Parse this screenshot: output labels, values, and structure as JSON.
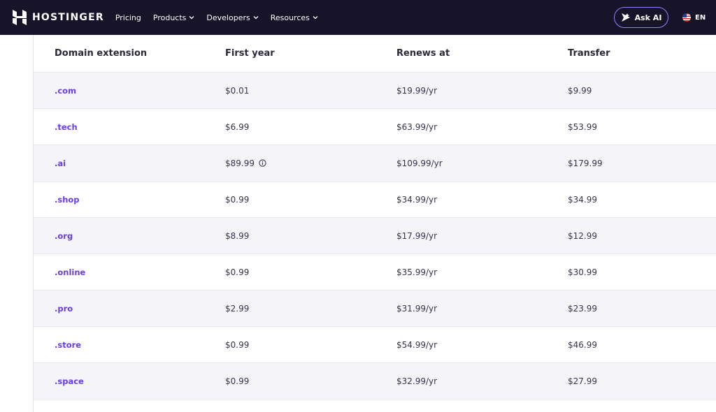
{
  "nav": {
    "brand": "HOSTINGER",
    "links": [
      {
        "label": "Pricing",
        "dropdown": false
      },
      {
        "label": "Products",
        "dropdown": true
      },
      {
        "label": "Developers",
        "dropdown": true
      },
      {
        "label": "Resources",
        "dropdown": true
      }
    ],
    "ask_ai": "Ask AI",
    "language": "EN"
  },
  "table": {
    "headers": [
      "Domain extension",
      "First year",
      "Renews at",
      "Transfer"
    ],
    "rows": [
      {
        "ext": ".com",
        "first": "$0.01",
        "renew": "$19.99/yr",
        "transfer": "$9.99"
      },
      {
        "ext": ".tech",
        "first": "$6.99",
        "renew": "$63.99/yr",
        "transfer": "$53.99"
      },
      {
        "ext": ".ai",
        "first": "$89.99",
        "renew": "$109.99/yr",
        "transfer": "$179.99",
        "info": true
      },
      {
        "ext": ".shop",
        "first": "$0.99",
        "renew": "$34.99/yr",
        "transfer": "$34.99"
      },
      {
        "ext": ".org",
        "first": "$8.99",
        "renew": "$17.99/yr",
        "transfer": "$12.99"
      },
      {
        "ext": ".online",
        "first": "$0.99",
        "renew": "$35.99/yr",
        "transfer": "$30.99"
      },
      {
        "ext": ".pro",
        "first": "$2.99",
        "renew": "$31.99/yr",
        "transfer": "$23.99"
      },
      {
        "ext": ".store",
        "first": "$0.99",
        "renew": "$54.99/yr",
        "transfer": "$46.99"
      },
      {
        "ext": ".space",
        "first": "$0.99",
        "renew": "$32.99/yr",
        "transfer": "$27.99"
      }
    ]
  },
  "colors": {
    "nav_bg": "#171329",
    "accent": "#673de6",
    "row_alt": "#f5f5f9"
  }
}
